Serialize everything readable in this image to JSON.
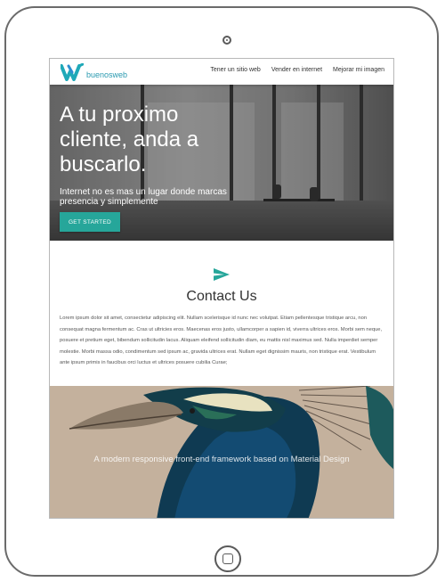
{
  "brand": {
    "name": "buenosweb",
    "accent": "#26a69a",
    "logo_color": "#2a9ab0"
  },
  "nav": {
    "links": [
      "Tener un sitio web",
      "Vender en internet",
      "Mejorar mi imagen"
    ]
  },
  "hero": {
    "title": "A tu proximo\ncliente, anda a\nbuscarlo.",
    "subtitle": "Internet no es mas un lugar donde marcas presencia y simplemente",
    "cta_label": "GET STARTED"
  },
  "contact": {
    "icon": "send-icon",
    "title": "Contact Us",
    "body": "Lorem ipsum dolor sit amet, consectetur adipiscing elit. Nullam scelerisque id nunc nec volutpat. Etiam pellentesque tristique arcu, non consequat magna fermentum ac. Cras ut ultricies eros. Maecenas eros justo, ullamcorper a sapien id, viverra ultrices eros. Morbi sem neque, posuere et pretium eget, bibendum sollicitudin lacus. Aliquam eleifend sollicitudin diam, eu mattis nisl maximus sed. Nulla imperdiet semper molestie. Morbi massa odio, condimentum sed ipsum ac, gravida ultrices erat. Nullam eget dignissim mauris, non tristique erat. Vestibulum ante ipsum primis in faucibus orci luctus et ultrices posuere cubilia Curae;"
  },
  "parallax": {
    "caption": "A modern responsive front-end framework based on Material Design"
  }
}
